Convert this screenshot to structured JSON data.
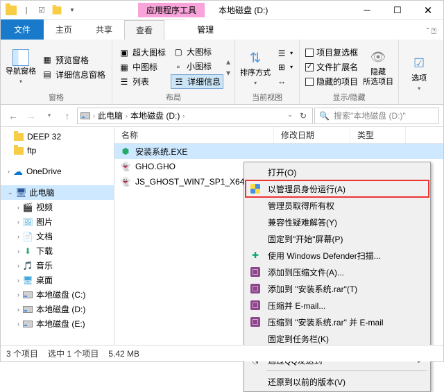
{
  "titlebar": {
    "tools_tab": "应用程序工具",
    "title": "本地磁盘 (D:)"
  },
  "tabs": {
    "file": "文件",
    "home": "主页",
    "share": "共享",
    "view": "查看",
    "manage": "管理"
  },
  "ribbon": {
    "nav_pane": "导航窗格",
    "preview_pane": "预览窗格",
    "detail_pane": "详细信息窗格",
    "panes_label": "窗格",
    "xl_icons": "超大图标",
    "l_icons": "大图标",
    "m_icons": "中图标",
    "s_icons": "小图标",
    "list": "列表",
    "details": "详细信息",
    "layout_label": "布局",
    "sort": "排序方式",
    "current_view_label": "当前视图",
    "item_checkbox": "项目复选框",
    "file_ext": "文件扩展名",
    "hidden_items": "隐藏的项目",
    "hide_selected": "隐藏\n所选项目",
    "showhide_label": "显示/隐藏",
    "options": "选项"
  },
  "address": {
    "this_pc": "此电脑",
    "drive": "本地磁盘 (D:)"
  },
  "search": {
    "placeholder": "搜索\"本地磁盘 (D:)\""
  },
  "tree": {
    "deep32": "DEEP 32",
    "ftp": "ftp",
    "onedrive": "OneDrive",
    "this_pc": "此电脑",
    "videos": "视频",
    "pictures": "图片",
    "documents": "文档",
    "downloads": "下载",
    "music": "音乐",
    "desktop": "桌面",
    "drive_c": "本地磁盘 (C:)",
    "drive_d": "本地磁盘 (D:)",
    "drive_e": "本地磁盘 (E:)"
  },
  "columns": {
    "name": "名称",
    "modified": "修改日期",
    "type": "类型"
  },
  "files": {
    "exe": "安装系统.EXE",
    "gho": "GHO.GHO",
    "ghost": "JS_GHOST_WIN7_SP1_X64_"
  },
  "context": {
    "open": "打开(O)",
    "run_admin": "以管理员身份运行(A)",
    "admin_owner": "管理员取得所有权",
    "compat": "兼容性疑难解答(Y)",
    "pin_start": "固定到\"开始\"屏幕(P)",
    "defender": "使用 Windows Defender扫描...",
    "add_archive": "添加到压缩文件(A)...",
    "add_rar": "添加到 \"安装系统.rar\"(T)",
    "compress_email": "压缩并 E-mail...",
    "compress_rar_email": "压缩到 \"安装系统.rar\" 并 E-mail",
    "pin_taskbar": "固定到任务栏(K)",
    "qq_send": "通过QQ发送到",
    "restore_prev": "还原到以前的版本(V)"
  },
  "status": {
    "items": "3 个项目",
    "selected": "选中 1 个项目",
    "size": "5.42 MB"
  }
}
